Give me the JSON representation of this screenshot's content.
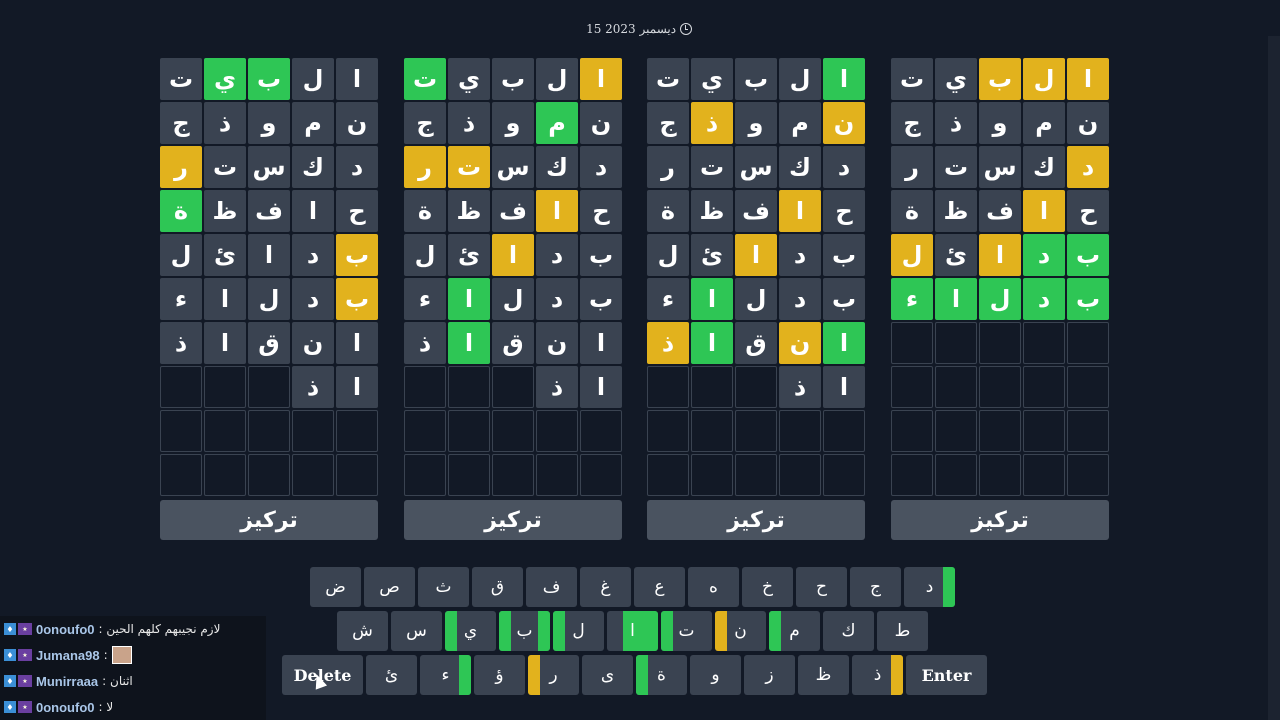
{
  "date": "15 ديسمبر 2023",
  "focus_label": "تركيز",
  "colors": {
    "green": "#2ec655",
    "yellow": "#e2b21d",
    "tile": "#3a4351",
    "background": "#121926"
  },
  "boards": [
    {
      "rows": [
        [
          [
            "ا",
            "y"
          ],
          [
            "ل",
            "y"
          ],
          [
            "ب",
            "y"
          ],
          [
            "ي",
            ""
          ],
          [
            "ت",
            ""
          ]
        ],
        [
          [
            "ن",
            ""
          ],
          [
            "م",
            ""
          ],
          [
            "و",
            ""
          ],
          [
            "ذ",
            ""
          ],
          [
            "ج",
            ""
          ]
        ],
        [
          [
            "د",
            "y"
          ],
          [
            "ك",
            ""
          ],
          [
            "س",
            ""
          ],
          [
            "ت",
            ""
          ],
          [
            "ر",
            ""
          ]
        ],
        [
          [
            "ح",
            ""
          ],
          [
            "ا",
            "y"
          ],
          [
            "ف",
            ""
          ],
          [
            "ظ",
            ""
          ],
          [
            "ة",
            ""
          ]
        ],
        [
          [
            "ب",
            "g"
          ],
          [
            "د",
            "g"
          ],
          [
            "ا",
            "y"
          ],
          [
            "ئ",
            ""
          ],
          [
            "ل",
            "y"
          ]
        ],
        [
          [
            "ب",
            "g"
          ],
          [
            "د",
            "g"
          ],
          [
            "ل",
            "g"
          ],
          [
            "ا",
            "g"
          ],
          [
            "ء",
            "g"
          ]
        ],
        [
          [
            "",
            "e"
          ],
          [
            "",
            "e"
          ],
          [
            "",
            "e"
          ],
          [
            "",
            "e"
          ],
          [
            "",
            "e"
          ]
        ],
        [
          [
            "",
            "e"
          ],
          [
            "",
            "e"
          ],
          [
            "",
            "e"
          ],
          [
            "",
            "e"
          ],
          [
            "",
            "e"
          ]
        ],
        [
          [
            "",
            "e"
          ],
          [
            "",
            "e"
          ],
          [
            "",
            "e"
          ],
          [
            "",
            "e"
          ],
          [
            "",
            "e"
          ]
        ],
        [
          [
            "",
            "e"
          ],
          [
            "",
            "e"
          ],
          [
            "",
            "e"
          ],
          [
            "",
            "e"
          ],
          [
            "",
            "e"
          ]
        ]
      ]
    },
    {
      "rows": [
        [
          [
            "ا",
            "g"
          ],
          [
            "ل",
            ""
          ],
          [
            "ب",
            ""
          ],
          [
            "ي",
            ""
          ],
          [
            "ت",
            ""
          ]
        ],
        [
          [
            "ن",
            "y"
          ],
          [
            "م",
            ""
          ],
          [
            "و",
            ""
          ],
          [
            "ذ",
            "y"
          ],
          [
            "ج",
            ""
          ]
        ],
        [
          [
            "د",
            ""
          ],
          [
            "ك",
            ""
          ],
          [
            "س",
            ""
          ],
          [
            "ت",
            ""
          ],
          [
            "ر",
            ""
          ]
        ],
        [
          [
            "ح",
            ""
          ],
          [
            "ا",
            "y"
          ],
          [
            "ف",
            ""
          ],
          [
            "ظ",
            ""
          ],
          [
            "ة",
            ""
          ]
        ],
        [
          [
            "ب",
            ""
          ],
          [
            "د",
            ""
          ],
          [
            "ا",
            "y"
          ],
          [
            "ئ",
            ""
          ],
          [
            "ل",
            ""
          ]
        ],
        [
          [
            "ب",
            ""
          ],
          [
            "د",
            ""
          ],
          [
            "ل",
            ""
          ],
          [
            "ا",
            "g"
          ],
          [
            "ء",
            ""
          ]
        ],
        [
          [
            "ا",
            "g"
          ],
          [
            "ن",
            "y"
          ],
          [
            "ق",
            ""
          ],
          [
            "ا",
            "g"
          ],
          [
            "ذ",
            "y"
          ]
        ],
        [
          [
            "ا",
            ""
          ],
          [
            "ذ",
            ""
          ],
          [
            "",
            "e"
          ],
          [
            "",
            "e"
          ],
          [
            "",
            "e"
          ]
        ],
        [
          [
            "",
            "e"
          ],
          [
            "",
            "e"
          ],
          [
            "",
            "e"
          ],
          [
            "",
            "e"
          ],
          [
            "",
            "e"
          ]
        ],
        [
          [
            "",
            "e"
          ],
          [
            "",
            "e"
          ],
          [
            "",
            "e"
          ],
          [
            "",
            "e"
          ],
          [
            "",
            "e"
          ]
        ]
      ]
    },
    {
      "rows": [
        [
          [
            "ا",
            "y"
          ],
          [
            "ل",
            ""
          ],
          [
            "ب",
            ""
          ],
          [
            "ي",
            ""
          ],
          [
            "ت",
            "g"
          ]
        ],
        [
          [
            "ن",
            ""
          ],
          [
            "م",
            "g"
          ],
          [
            "و",
            ""
          ],
          [
            "ذ",
            ""
          ],
          [
            "ج",
            ""
          ]
        ],
        [
          [
            "د",
            ""
          ],
          [
            "ك",
            ""
          ],
          [
            "س",
            ""
          ],
          [
            "ت",
            "y"
          ],
          [
            "ر",
            "y"
          ]
        ],
        [
          [
            "ح",
            ""
          ],
          [
            "ا",
            "y"
          ],
          [
            "ف",
            ""
          ],
          [
            "ظ",
            ""
          ],
          [
            "ة",
            ""
          ]
        ],
        [
          [
            "ب",
            ""
          ],
          [
            "د",
            ""
          ],
          [
            "ا",
            "y"
          ],
          [
            "ئ",
            ""
          ],
          [
            "ل",
            ""
          ]
        ],
        [
          [
            "ب",
            ""
          ],
          [
            "د",
            ""
          ],
          [
            "ل",
            ""
          ],
          [
            "ا",
            "g"
          ],
          [
            "ء",
            ""
          ]
        ],
        [
          [
            "ا",
            ""
          ],
          [
            "ن",
            ""
          ],
          [
            "ق",
            ""
          ],
          [
            "ا",
            "g"
          ],
          [
            "ذ",
            ""
          ]
        ],
        [
          [
            "ا",
            ""
          ],
          [
            "ذ",
            ""
          ],
          [
            "",
            "e"
          ],
          [
            "",
            "e"
          ],
          [
            "",
            "e"
          ]
        ],
        [
          [
            "",
            "e"
          ],
          [
            "",
            "e"
          ],
          [
            "",
            "e"
          ],
          [
            "",
            "e"
          ],
          [
            "",
            "e"
          ]
        ],
        [
          [
            "",
            "e"
          ],
          [
            "",
            "e"
          ],
          [
            "",
            "e"
          ],
          [
            "",
            "e"
          ],
          [
            "",
            "e"
          ]
        ]
      ]
    },
    {
      "rows": [
        [
          [
            "ا",
            ""
          ],
          [
            "ل",
            ""
          ],
          [
            "ب",
            "g"
          ],
          [
            "ي",
            "g"
          ],
          [
            "ت",
            ""
          ]
        ],
        [
          [
            "ن",
            ""
          ],
          [
            "م",
            ""
          ],
          [
            "و",
            ""
          ],
          [
            "ذ",
            ""
          ],
          [
            "ج",
            ""
          ]
        ],
        [
          [
            "د",
            ""
          ],
          [
            "ك",
            ""
          ],
          [
            "س",
            ""
          ],
          [
            "ت",
            ""
          ],
          [
            "ر",
            "y"
          ]
        ],
        [
          [
            "ح",
            ""
          ],
          [
            "ا",
            ""
          ],
          [
            "ف",
            ""
          ],
          [
            "ظ",
            ""
          ],
          [
            "ة",
            "g"
          ]
        ],
        [
          [
            "ب",
            "y"
          ],
          [
            "د",
            ""
          ],
          [
            "ا",
            ""
          ],
          [
            "ئ",
            ""
          ],
          [
            "ل",
            ""
          ]
        ],
        [
          [
            "ب",
            "y"
          ],
          [
            "د",
            ""
          ],
          [
            "ل",
            ""
          ],
          [
            "ا",
            ""
          ],
          [
            "ء",
            ""
          ]
        ],
        [
          [
            "ا",
            ""
          ],
          [
            "ن",
            ""
          ],
          [
            "ق",
            ""
          ],
          [
            "ا",
            ""
          ],
          [
            "ذ",
            ""
          ]
        ],
        [
          [
            "ا",
            ""
          ],
          [
            "ذ",
            ""
          ],
          [
            "",
            "e"
          ],
          [
            "",
            "e"
          ],
          [
            "",
            "e"
          ]
        ],
        [
          [
            "",
            "e"
          ],
          [
            "",
            "e"
          ],
          [
            "",
            "e"
          ],
          [
            "",
            "e"
          ],
          [
            "",
            "e"
          ]
        ],
        [
          [
            "",
            "e"
          ],
          [
            "",
            "e"
          ],
          [
            "",
            "e"
          ],
          [
            "",
            "e"
          ],
          [
            "",
            "e"
          ]
        ]
      ]
    }
  ],
  "keyboard": {
    "row1": [
      {
        "k": "د",
        "m": [
          [
            "r",
            "g"
          ]
        ]
      },
      {
        "k": "ج",
        "m": []
      },
      {
        "k": "ح",
        "m": []
      },
      {
        "k": "خ",
        "m": []
      },
      {
        "k": "ه",
        "m": []
      },
      {
        "k": "ع",
        "m": []
      },
      {
        "k": "غ",
        "m": []
      },
      {
        "k": "ف",
        "m": []
      },
      {
        "k": "ق",
        "m": []
      },
      {
        "k": "ث",
        "m": []
      },
      {
        "k": "ص",
        "m": []
      },
      {
        "k": "ض",
        "m": []
      }
    ],
    "row2": [
      {
        "k": "ط",
        "m": []
      },
      {
        "k": "ك",
        "m": []
      },
      {
        "k": "م",
        "m": [
          [
            "l",
            "g"
          ]
        ]
      },
      {
        "k": "ن",
        "m": [
          [
            "l",
            "y"
          ]
        ]
      },
      {
        "k": "ت",
        "m": [
          [
            "l",
            "g"
          ]
        ]
      },
      {
        "k": "ا",
        "m": [
          [
            "full",
            "g"
          ]
        ]
      },
      {
        "k": "ل",
        "m": [
          [
            "l",
            "g"
          ]
        ]
      },
      {
        "k": "ب",
        "m": [
          [
            "r",
            "g"
          ],
          [
            "l",
            "g"
          ]
        ]
      },
      {
        "k": "ي",
        "m": [
          [
            "l",
            "g"
          ]
        ]
      },
      {
        "k": "س",
        "m": []
      },
      {
        "k": "ش",
        "m": []
      }
    ],
    "row3": [
      {
        "k": "Enter",
        "wide": true,
        "m": []
      },
      {
        "k": "ذ",
        "m": [
          [
            "r",
            "y"
          ]
        ]
      },
      {
        "k": "ظ",
        "m": []
      },
      {
        "k": "ز",
        "m": []
      },
      {
        "k": "و",
        "m": []
      },
      {
        "k": "ة",
        "m": [
          [
            "l",
            "g"
          ]
        ]
      },
      {
        "k": "ى",
        "m": []
      },
      {
        "k": "ر",
        "m": [
          [
            "l",
            "y"
          ]
        ]
      },
      {
        "k": "ؤ",
        "m": []
      },
      {
        "k": "ء",
        "m": [
          [
            "r",
            "g"
          ]
        ]
      },
      {
        "k": "ئ",
        "m": []
      },
      {
        "k": "Delete",
        "wide": true,
        "m": []
      }
    ]
  },
  "chat": [
    {
      "user": "0onoufo0",
      "msg": ": لازم نجيبهم كلهم الحين",
      "pic": false
    },
    {
      "user": "Jumana98",
      "msg": ":",
      "pic": true
    },
    {
      "user": "Munirraaa",
      "msg": ": اثنان",
      "pic": false
    },
    {
      "user": "0onoufo0",
      "msg": ": لا",
      "pic": false
    }
  ]
}
